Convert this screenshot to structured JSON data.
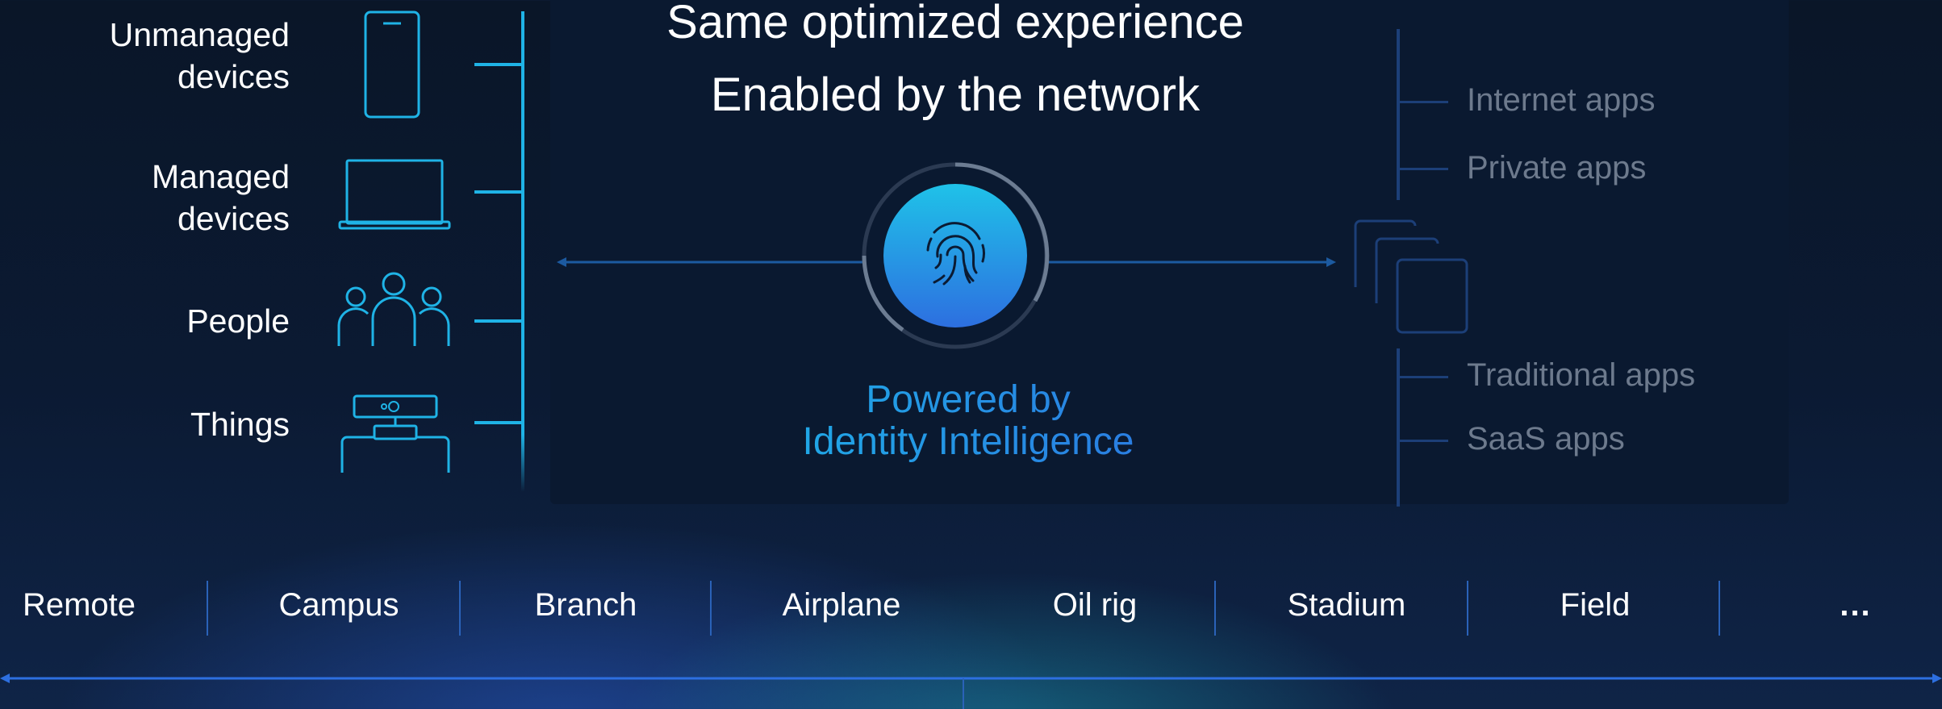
{
  "header": {
    "title_line1": "Same optimized experience",
    "title_line2": "Enabled by the network"
  },
  "endpoints": [
    {
      "label_line1": "Unmanaged",
      "label_line2": "devices",
      "icon": "smartphone-icon"
    },
    {
      "label_line1": "Managed",
      "label_line2": "devices",
      "icon": "laptop-icon"
    },
    {
      "label_line1": "People",
      "label_line2": "",
      "icon": "people-group-icon"
    },
    {
      "label_line1": "Things",
      "label_line2": "",
      "icon": "camera-device-icon"
    }
  ],
  "center": {
    "icon": "fingerprint-icon",
    "caption_line1": "Powered by",
    "caption_line2": "Identity Intelligence"
  },
  "apps": {
    "icon": "stacked-windows-icon",
    "top": [
      "Internet apps",
      "Private apps"
    ],
    "bottom": [
      "Traditional apps",
      "SaaS apps"
    ]
  },
  "locations": [
    "Remote",
    "Campus",
    "Branch",
    "Airplane",
    "Oil rig",
    "Stadium",
    "Field",
    "..."
  ],
  "colors": {
    "accent_cyan": "#1fb3e6",
    "accent_blue": "#2d6fe0",
    "muted_text": "#6d7a8d",
    "background": "#0a1628"
  }
}
